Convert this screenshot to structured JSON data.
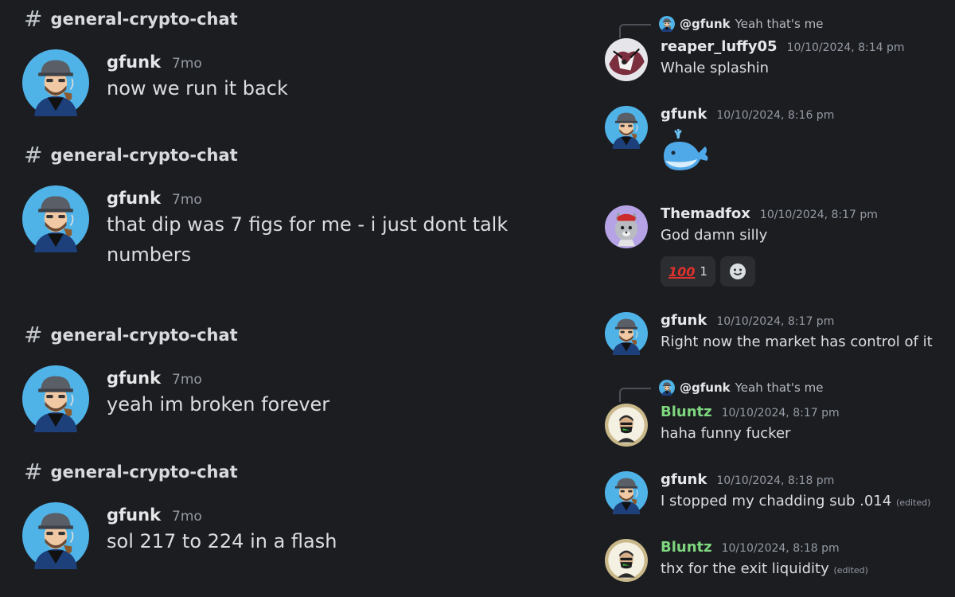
{
  "left": {
    "blocks": [
      {
        "channel": "general-crypto-chat",
        "author": "gfunk",
        "time": "7mo",
        "text": "now we run it back"
      },
      {
        "channel": "general-crypto-chat",
        "author": "gfunk",
        "time": "7mo",
        "text": "that dip was 7 figs for me - i just dont talk numbers"
      },
      {
        "channel": "general-crypto-chat",
        "author": "gfunk",
        "time": "7mo",
        "text": "yeah im broken forever"
      },
      {
        "channel": "general-crypto-chat",
        "author": "gfunk",
        "time": "7mo",
        "text": "sol 217 to 224 in a flash"
      }
    ]
  },
  "right": {
    "reply1": {
      "name": "@gfunk",
      "text": "Yeah that's me"
    },
    "msg1": {
      "author": "reaper_luffy05",
      "time": "10/10/2024, 8:14 pm",
      "text": "Whale splashin"
    },
    "msg2": {
      "author": "gfunk",
      "time": "10/10/2024, 8:16 pm",
      "emoji": "whale-emoji"
    },
    "msg3": {
      "author": "Themadfox",
      "time": "10/10/2024, 8:17 pm",
      "text": "God damn silly"
    },
    "reaction": {
      "emoji": "100",
      "count": "1"
    },
    "msg4": {
      "author": "gfunk",
      "time": "10/10/2024, 8:17 pm",
      "text": "Right now the market has control of it"
    },
    "reply2": {
      "name": "@gfunk",
      "text": "Yeah that's me"
    },
    "msg5": {
      "author": "Bluntz",
      "time": "10/10/2024, 8:17 pm",
      "text": "haha funny fucker"
    },
    "msg6": {
      "author": "gfunk",
      "time": "10/10/2024, 8:18 pm",
      "text": "I stopped my chadding sub .014",
      "edited": "(edited)"
    },
    "msg7": {
      "author": "Bluntz",
      "time": "10/10/2024, 8:18 pm",
      "text": "thx for the exit liquidity",
      "edited": "(edited)"
    }
  },
  "colors": {
    "background": "#1c1d21",
    "green_name": "#7ed67e",
    "muted": "#949ba4"
  }
}
